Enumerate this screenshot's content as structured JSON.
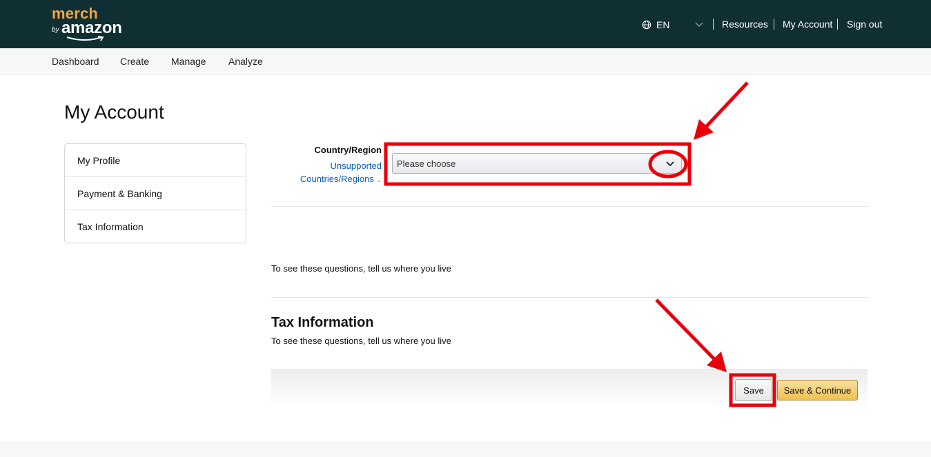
{
  "header": {
    "logo": {
      "line1": "merch",
      "by": "by",
      "brand": "amazon"
    },
    "language": {
      "icon": "globe-icon",
      "code": "EN"
    },
    "links": [
      "Resources",
      "My Account",
      "Sign out"
    ]
  },
  "subnav": {
    "items": [
      "Dashboard",
      "Create",
      "Manage",
      "Analyze"
    ]
  },
  "page": {
    "title": "My Account"
  },
  "sidebar": {
    "items": [
      {
        "label": "My Profile"
      },
      {
        "label": "Payment & Banking"
      },
      {
        "label": "Tax Information"
      }
    ]
  },
  "form": {
    "country_label": "Country/Region",
    "unsupported_line1": "Unsupported",
    "unsupported_line2": "Countries/Regions",
    "select_value": "Please choose",
    "message": "To see these questions, tell us where you live"
  },
  "tax": {
    "title": "Tax Information",
    "message": "To see these questions, tell us where you live"
  },
  "actions": {
    "save_label": "Save",
    "continue_label": "Save & Continue"
  },
  "colors": {
    "header_bg": "#0f2f33",
    "brand_orange": "#f0a443",
    "link_blue": "#0b5bb5",
    "annotation_red": "#e8000b",
    "primary_button": "#f0c14b"
  }
}
